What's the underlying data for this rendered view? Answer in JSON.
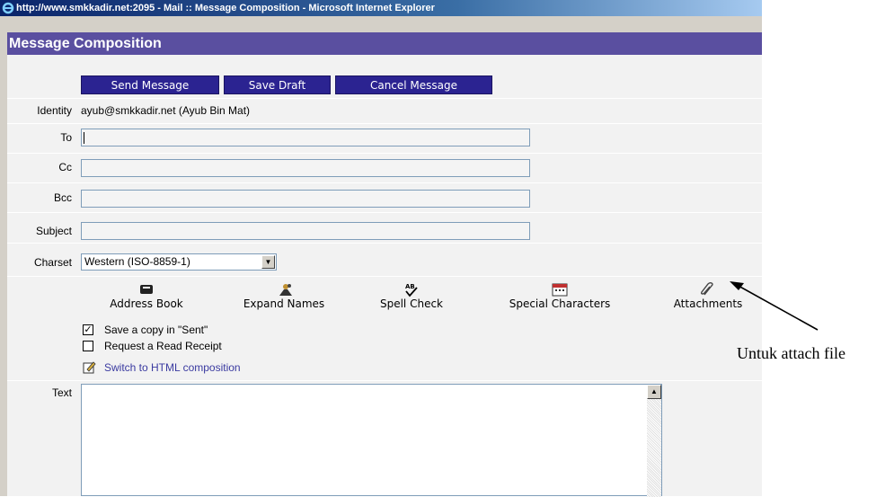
{
  "window": {
    "title": "http://www.smkkadir.net:2095 - Mail :: Message Composition - Microsoft Internet Explorer"
  },
  "page": {
    "heading": "Message Composition"
  },
  "toolbar": {
    "send_label": "Send Message",
    "save_label": "Save Draft",
    "cancel_label": "Cancel Message"
  },
  "form": {
    "identity_label": "Identity",
    "identity_value": "ayub@smkkadir.net (Ayub Bin Mat)",
    "to_label": "To",
    "to_value": "",
    "cc_label": "Cc",
    "cc_value": "",
    "bcc_label": "Bcc",
    "bcc_value": "",
    "subject_label": "Subject",
    "subject_value": "",
    "charset_label": "Charset",
    "charset_value": "Western (ISO-8859-1)",
    "text_label": "Text"
  },
  "tools": {
    "address_book": "Address Book",
    "expand_names": "Expand Names",
    "spell_check": "Spell Check",
    "special_characters": "Special Characters",
    "attachments": "Attachments"
  },
  "options": {
    "save_copy_label": "Save a copy in \"Sent\"",
    "save_copy_checked": true,
    "read_receipt_label": "Request a Read Receipt",
    "read_receipt_checked": false,
    "html_link": "Switch to HTML composition"
  },
  "annotation": {
    "text": "Untuk attach file"
  },
  "colors": {
    "header_bg": "#5a4fa0",
    "button_bg": "#2b2391",
    "panel_bg": "#f2f2f2"
  }
}
